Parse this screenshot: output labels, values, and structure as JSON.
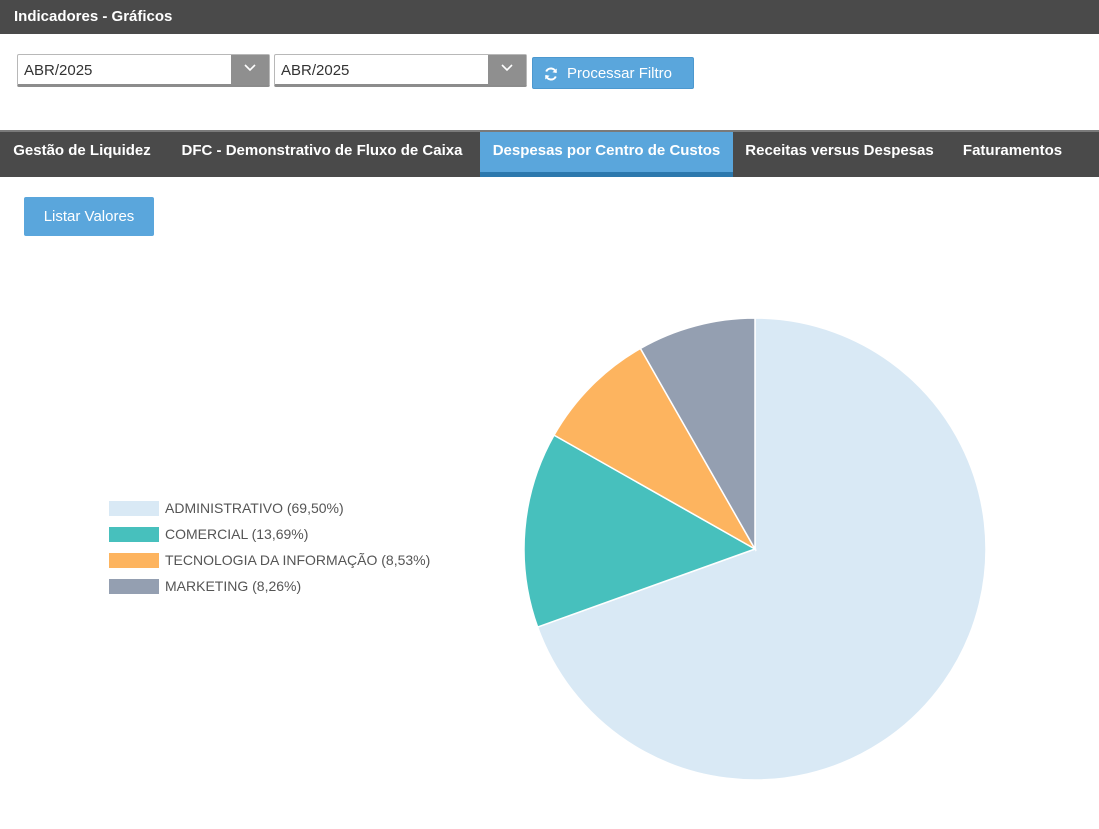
{
  "window": {
    "title": "Indicadores - Gráficos"
  },
  "filters": {
    "start_period": "ABR/2025",
    "end_period": "ABR/2025",
    "process_button": "Processar Filtro",
    "process_icon": "refresh-icon"
  },
  "tabs": [
    {
      "label": "Gestão de Liquidez",
      "active": false
    },
    {
      "label": "DFC - Demonstrativo de Fluxo de Caixa",
      "active": false
    },
    {
      "label": "Despesas por Centro de Custos",
      "active": true
    },
    {
      "label": "Receitas versus Despesas",
      "active": false
    },
    {
      "label": "Faturamentos",
      "active": false
    }
  ],
  "list_values_button": "Listar Valores",
  "colors": {
    "header_bg": "#4a4a4a",
    "accent": "#5aa6dc"
  },
  "chart_data": {
    "type": "pie",
    "legend_position": "left",
    "series": [
      {
        "name": "ADMINISTRATIVO",
        "value": 69.5,
        "label": "ADMINISTRATIVO (69,50%)",
        "color": "#d9e9f5"
      },
      {
        "name": "COMERCIAL",
        "value": 13.69,
        "label": "COMERCIAL (13,69%)",
        "color": "#47c0bd"
      },
      {
        "name": "TECNOLOGIA DA INFORMAÇÃO",
        "value": 8.53,
        "label": "TECNOLOGIA DA INFORMAÇÃO (8,53%)",
        "color": "#fdb45f"
      },
      {
        "name": "MARKETING",
        "value": 8.26,
        "label": "MARKETING (8,26%)",
        "color": "#949fb1"
      }
    ]
  }
}
